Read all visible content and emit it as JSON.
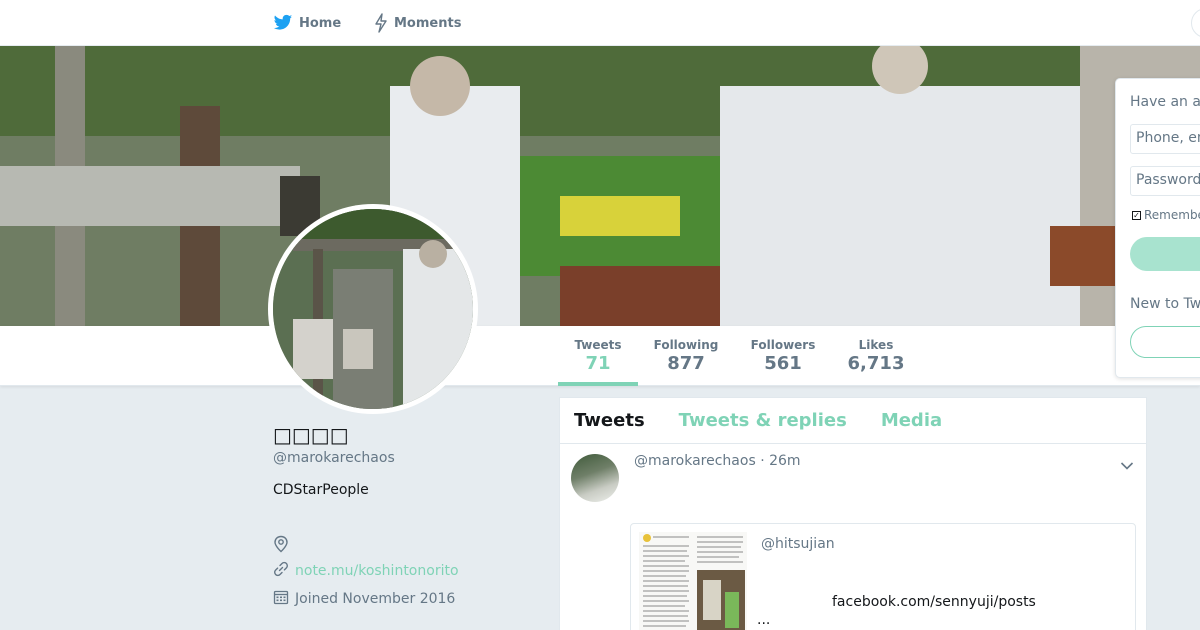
{
  "nav": {
    "home_label": "Home",
    "moments_label": "Moments"
  },
  "stats": [
    {
      "label": "Tweets",
      "value": "71"
    },
    {
      "label": "Following",
      "value": "877"
    },
    {
      "label": "Followers",
      "value": "561"
    },
    {
      "label": "Likes",
      "value": "6,713"
    }
  ],
  "profile": {
    "name": "□□□□",
    "handle": "@marokarechaos",
    "bio": "CDStarPeople",
    "website": "note.mu/koshintonorito",
    "joined": "Joined November 2016"
  },
  "timeline": {
    "tabs": [
      "Tweets",
      "Tweets & replies",
      "Media"
    ],
    "tweet": {
      "header": "@marokarechaos · 26m",
      "card": {
        "handle": "@hitsujian",
        "url": "facebook.com/sennyuji/posts",
        "ellipsis": "..."
      }
    }
  },
  "login": {
    "title": "Have an a",
    "phone_placeholder": "Phone, em",
    "password_placeholder": "Password",
    "remember": "Remembe",
    "new_to": "New to Tw"
  },
  "colors": {
    "accent": "#7fd3b6",
    "muted": "#657786",
    "bird": "#1da1f2"
  },
  "icons": {
    "home": "twitter-bird-icon",
    "moments": "lightning-icon",
    "location": "map-pin-icon",
    "link": "link-icon",
    "calendar": "calendar-icon",
    "caret": "chevron-down-icon"
  }
}
